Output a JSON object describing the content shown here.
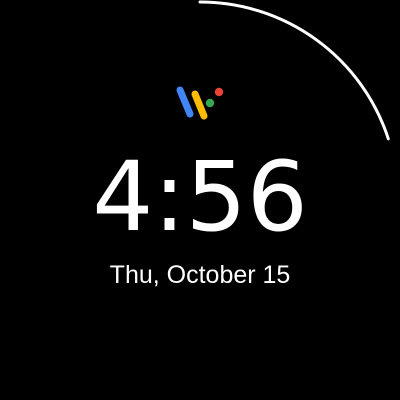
{
  "watch_face": {
    "time": "4:56",
    "date": "Thu, October 15",
    "minute_progress_fraction": 0.2
  },
  "colors": {
    "background": "#000000",
    "text": "#ffffff",
    "progress_ring": "#ffffff",
    "logo_blue": "#4285F4",
    "logo_yellow": "#FBBC05",
    "logo_green": "#34A853",
    "logo_red": "#EA4335"
  },
  "logo": {
    "icon": "wear-os-logo-icon"
  }
}
